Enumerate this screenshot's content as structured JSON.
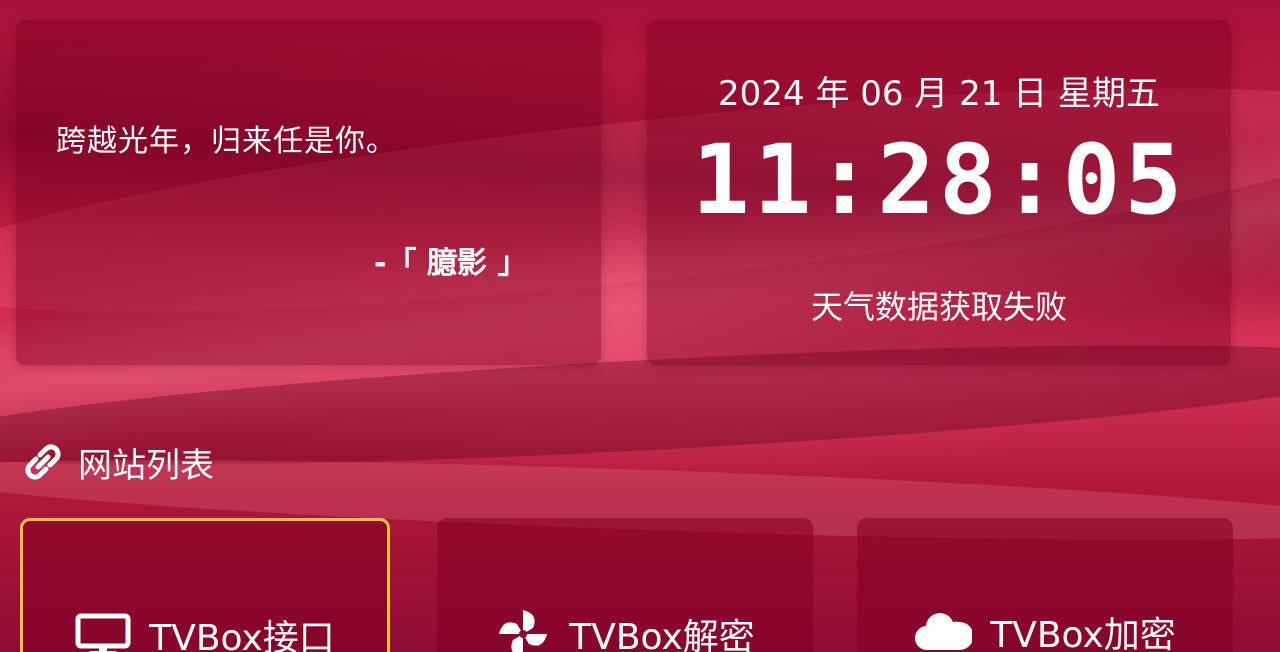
{
  "quote": {
    "text": "跨越光年，归来任是你。",
    "author": "-「 臆影 」"
  },
  "clock": {
    "date": "2024 年 06 月 21 日 星期五",
    "time": "11:28:05",
    "weather": "天气数据获取失败"
  },
  "section": {
    "title": "网站列表",
    "icon": "link-icon"
  },
  "tiles": [
    {
      "label": "TVBox接口",
      "icon": "monitor-icon",
      "selected": true
    },
    {
      "label": "TVBox解密",
      "icon": "pinwheel-icon",
      "selected": false
    },
    {
      "label": "TVBox加密",
      "icon": "cloud-icon",
      "selected": false
    }
  ],
  "colors": {
    "accent": "#f0c33a",
    "background": "#c0203f"
  }
}
